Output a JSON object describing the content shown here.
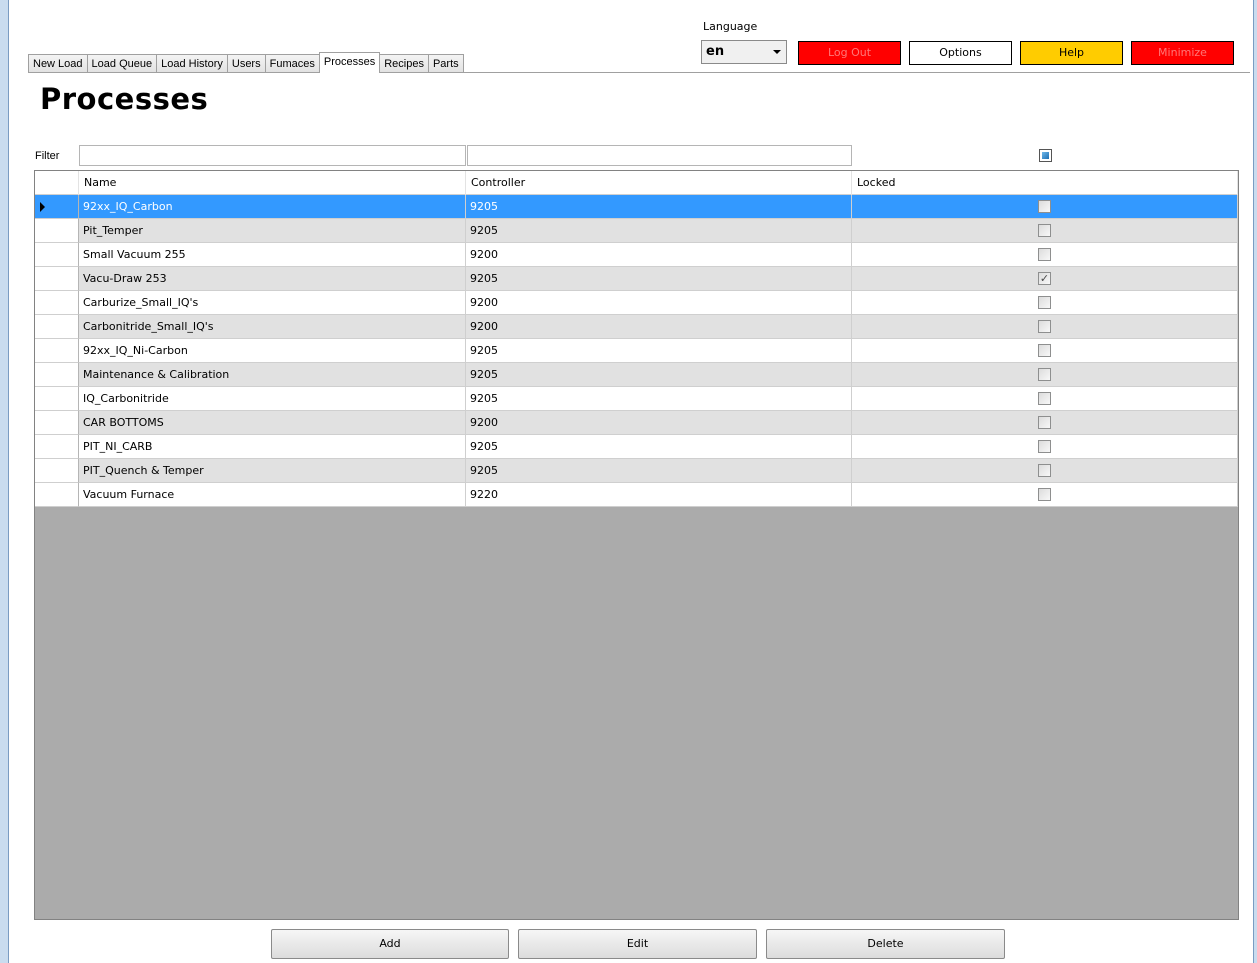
{
  "tabs": [
    "New Load",
    "Load Queue",
    "Load History",
    "Users",
    "Fumaces",
    "Processes",
    "Recipes",
    "Parts"
  ],
  "active_tab_index": 5,
  "language": {
    "label": "Language",
    "value": "en"
  },
  "header_buttons": {
    "logout": "Log Out",
    "options": "Options",
    "help": "Help",
    "minimize": "Minimize"
  },
  "colors": {
    "danger": "#ff0000",
    "warning": "#ffcc00",
    "selection": "#3399ff",
    "grid_empty": "#ababab"
  },
  "page_title": "Processes",
  "filter": {
    "label": "Filter",
    "name_value": "",
    "controller_value": ""
  },
  "table": {
    "columns": [
      "Name",
      "Controller",
      "Locked"
    ],
    "rows": [
      {
        "name": "92xx_IQ_Carbon",
        "controller": "9205",
        "locked": false,
        "selected": true
      },
      {
        "name": "Pit_Temper",
        "controller": "9205",
        "locked": false
      },
      {
        "name": "Small Vacuum 255",
        "controller": "9200",
        "locked": false
      },
      {
        "name": "Vacu-Draw 253",
        "controller": "9205",
        "locked": true
      },
      {
        "name": "Carburize_Small_IQ's",
        "controller": "9200",
        "locked": false
      },
      {
        "name": "Carbonitride_Small_IQ's",
        "controller": "9200",
        "locked": false
      },
      {
        "name": "92xx_IQ_Ni-Carbon",
        "controller": "9205",
        "locked": false
      },
      {
        "name": "Maintenance & Calibration",
        "controller": "9205",
        "locked": false
      },
      {
        "name": "IQ_Carbonitride",
        "controller": "9205",
        "locked": false
      },
      {
        "name": "CAR BOTTOMS",
        "controller": "9200",
        "locked": false
      },
      {
        "name": "PIT_NI_CARB",
        "controller": "9205",
        "locked": false
      },
      {
        "name": "PIT_Quench & Temper",
        "controller": "9205",
        "locked": false
      },
      {
        "name": "Vacuum Furnace",
        "controller": "9220",
        "locked": false
      }
    ]
  },
  "actions": {
    "add": "Add",
    "edit": "Edit",
    "delete": "Delete"
  }
}
